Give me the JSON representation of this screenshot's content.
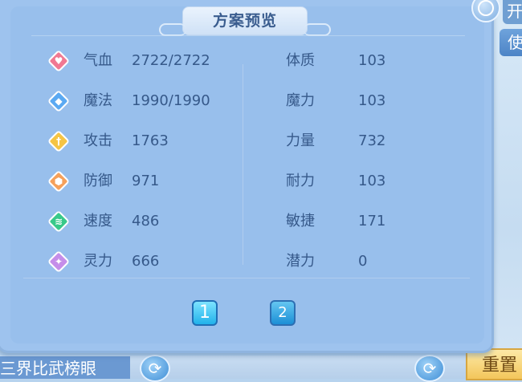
{
  "title": "方案预览",
  "left_stats": [
    {
      "label": "气血",
      "value": "2722/2722",
      "icon": "heart-icon",
      "color": "#f07892"
    },
    {
      "label": "魔法",
      "value": "1990/1990",
      "icon": "mana-diamond-icon",
      "color": "#5aa9f2"
    },
    {
      "label": "攻击",
      "value": "1763",
      "icon": "sword-icon",
      "color": "#f5c444"
    },
    {
      "label": "防御",
      "value": "971",
      "icon": "shield-icon",
      "color": "#f5a05a"
    },
    {
      "label": "速度",
      "value": "486",
      "icon": "lightning-icon",
      "color": "#38c98a"
    },
    {
      "label": "灵力",
      "value": "666",
      "icon": "spirit-icon",
      "color": "#c58de9"
    }
  ],
  "right_stats": [
    {
      "label": "体质",
      "value": "103"
    },
    {
      "label": "魔力",
      "value": "103"
    },
    {
      "label": "力量",
      "value": "732"
    },
    {
      "label": "耐力",
      "value": "103"
    },
    {
      "label": "敏捷",
      "value": "171"
    },
    {
      "label": "潜力",
      "value": "0"
    }
  ],
  "pages": [
    "1",
    "2"
  ],
  "active_page": "1",
  "background": {
    "top_right_button": "开",
    "side_button": "使",
    "bottom_label": "三界比武榜眼",
    "reset_button": "重置"
  }
}
